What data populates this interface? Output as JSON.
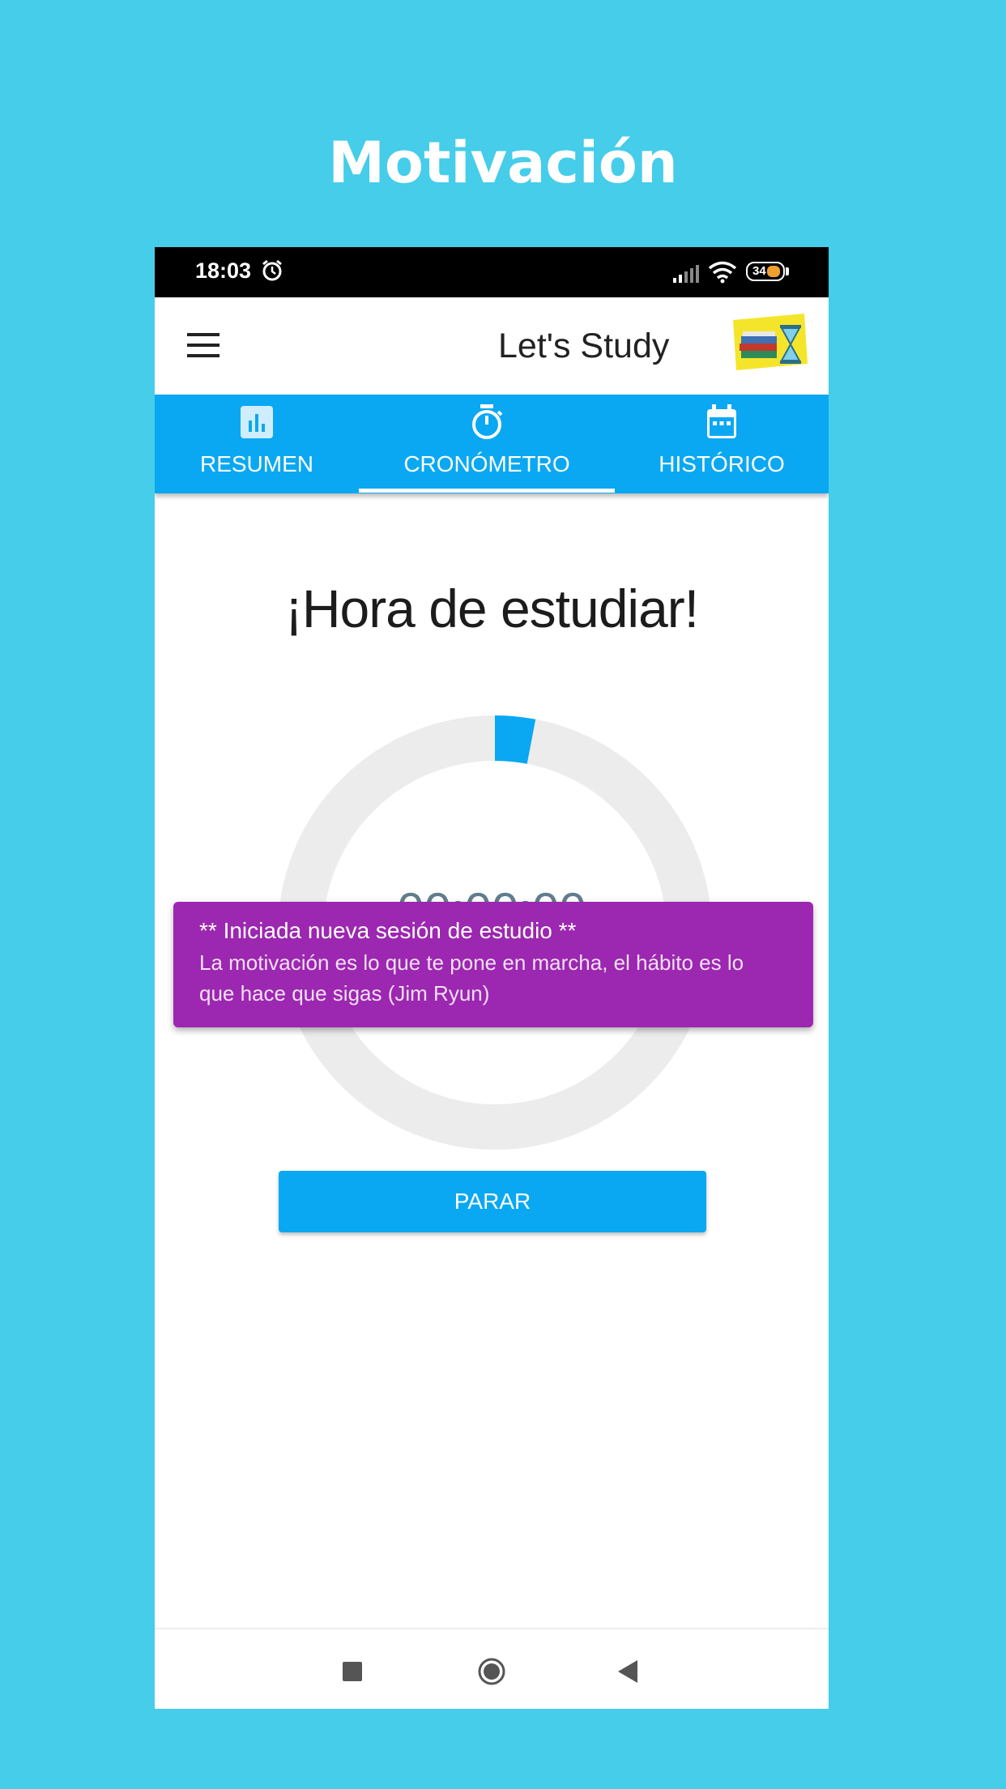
{
  "promo": {
    "title": "Motivación"
  },
  "status_bar": {
    "time": "18:03",
    "battery": "34",
    "icons": [
      "alarm-icon",
      "signal-icon",
      "wifi-icon",
      "battery-icon"
    ]
  },
  "app_bar": {
    "title": "Let's Study",
    "menu_icon": "hamburger-menu-icon",
    "logo": "books-hourglass-logo"
  },
  "tabs": [
    {
      "label": "RESUMEN",
      "icon": "bar-chart-icon",
      "selected": false
    },
    {
      "label": "CRONÓMETRO",
      "icon": "stopwatch-icon",
      "selected": true
    },
    {
      "label": "HISTÓRICO",
      "icon": "calendar-icon",
      "selected": false
    }
  ],
  "main": {
    "heading": "¡Hora de estudiar!",
    "timer": "00:00:00",
    "progress": 0.03,
    "stop_button": "PARAR"
  },
  "snackbar": {
    "title": "** Iniciada nueva sesión de estudio **",
    "message": "La motivación es lo que te pone en marcha, el hábito es lo que hace que sigas (Jim Ryun)"
  },
  "nav_bar": {
    "icons": [
      "recent-apps-icon",
      "home-icon",
      "back-icon"
    ]
  },
  "colors": {
    "background": "#45cdea",
    "primary": "#0aa8f2",
    "snackbar": "#9c27b0",
    "ring_track": "#ececec"
  }
}
